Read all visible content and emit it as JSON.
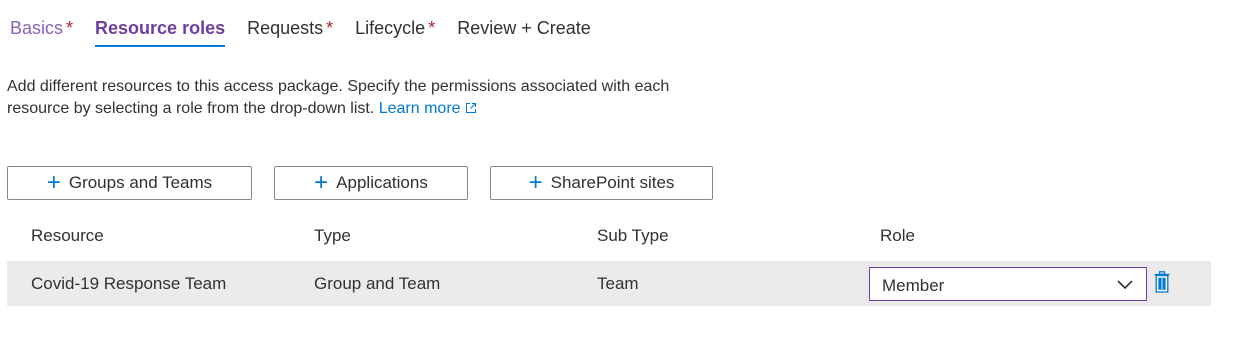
{
  "tabs": [
    {
      "label": "Basics",
      "required": "*",
      "state": "done"
    },
    {
      "label": "Resource roles",
      "required": "",
      "state": "active"
    },
    {
      "label": "Requests",
      "required": "*",
      "state": "normal"
    },
    {
      "label": "Lifecycle",
      "required": "*",
      "state": "normal"
    },
    {
      "label": "Review + Create",
      "required": "",
      "state": "normal"
    }
  ],
  "description": {
    "line1": "Add different resources to this access package. Specify the permissions associated with each",
    "line2": "resource by selecting a role from the drop-down list.",
    "learn_more": "Learn more"
  },
  "buttons": {
    "groups": "Groups and Teams",
    "apps": "Applications",
    "sharepoint": "SharePoint sites"
  },
  "table": {
    "headers": [
      "Resource",
      "Type",
      "Sub Type",
      "Role"
    ],
    "rows": [
      {
        "resource": "Covid-19 Response Team",
        "type": "Group and Team",
        "sub_type": "Team",
        "role": "Member"
      }
    ]
  },
  "colors": {
    "accent": "#0078d4",
    "active_tab": "#6b3fa0",
    "required": "#a4262c",
    "row_bg": "#edebe9"
  },
  "icons": {
    "add": "plus-icon",
    "external": "external-link-icon",
    "dropdown": "chevron-down-icon",
    "delete": "trash-icon"
  }
}
